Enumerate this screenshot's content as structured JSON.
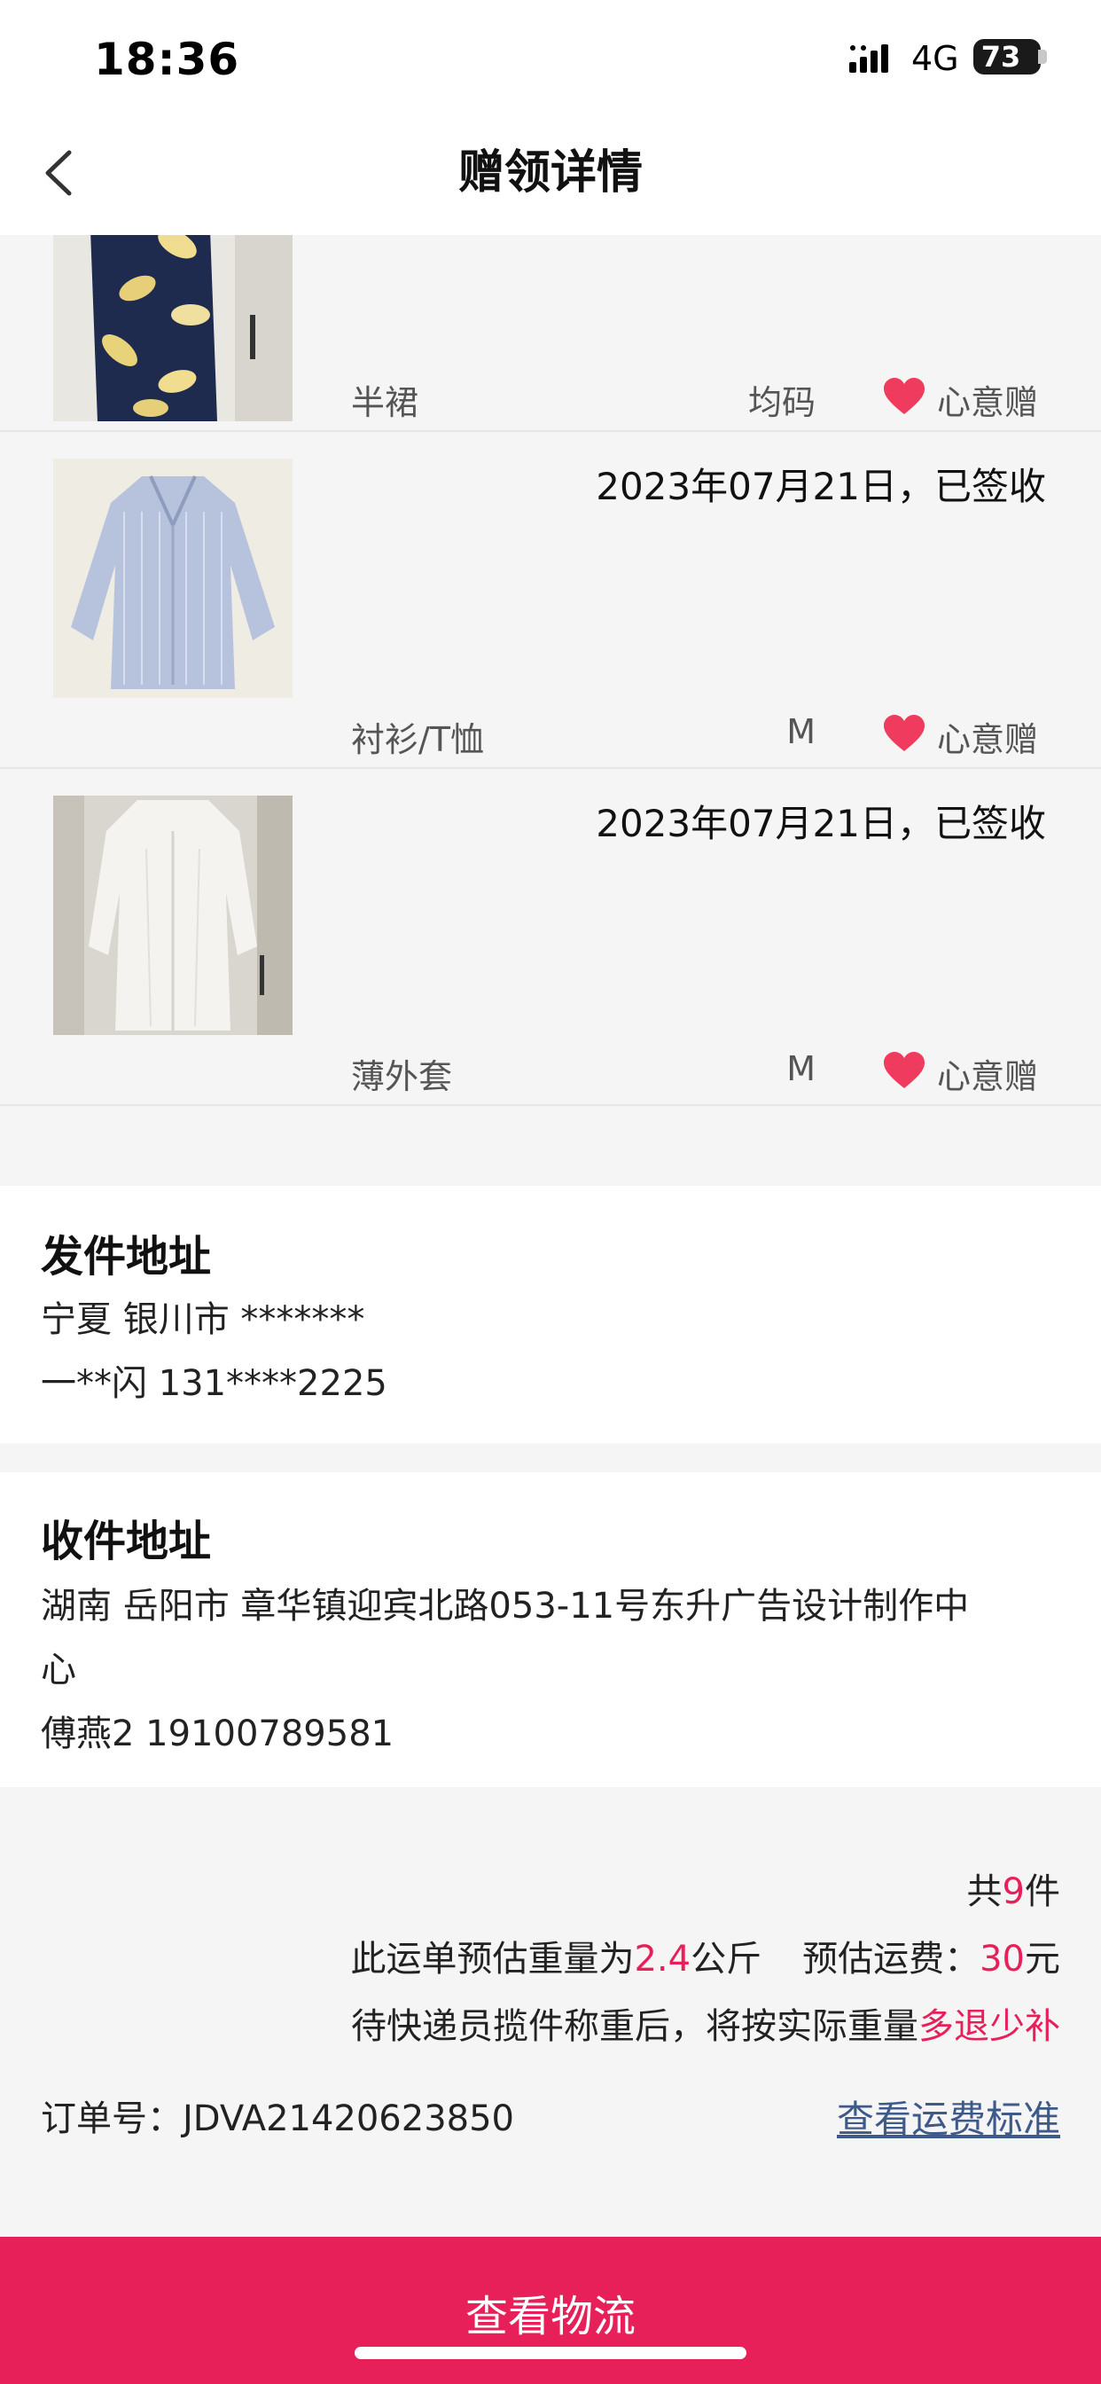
{
  "status_bar": {
    "time": "18:36",
    "network": "4G",
    "battery": "73"
  },
  "nav": {
    "title": "赠领详情"
  },
  "items": [
    {
      "category": "半裙",
      "size": "均码",
      "tag": "心意赠",
      "status": ""
    },
    {
      "category": "衬衫/T恤",
      "size": "M",
      "tag": "心意赠",
      "status": "2023年07月21日，已签收"
    },
    {
      "category": "薄外套",
      "size": "M",
      "tag": "心意赠",
      "status": "2023年07月21日，已签收"
    }
  ],
  "sender": {
    "title": "发件地址",
    "region": "宁夏 银川市 *******",
    "contact": "一**闪 131****2225"
  },
  "receiver": {
    "title": "收件地址",
    "address_line1": "湖南 岳阳市 章华镇迎宾北路053-11号东升广告设计制作中",
    "address_line2": "心",
    "contact": "傅燕2 19100789581"
  },
  "summary": {
    "total_prefix": "共",
    "total_count": "9",
    "total_suffix": "件",
    "weight_prefix": "此运单预估重量为",
    "weight_value": "2.4",
    "weight_unit": "公斤",
    "fee_label": "预估运费：",
    "fee_value": "30",
    "fee_unit": "元",
    "note_prefix": "待快递员揽件称重后，将按实际重量",
    "note_highlight": "多退少补",
    "order_label": "订单号：",
    "order_no": "JDVA21420623850",
    "fee_link": "查看运费标准"
  },
  "bottom": {
    "button_label": "查看物流"
  },
  "colors": {
    "accent": "#e8205a",
    "heart": "#ef3b5d",
    "link": "#3d5a8a"
  }
}
